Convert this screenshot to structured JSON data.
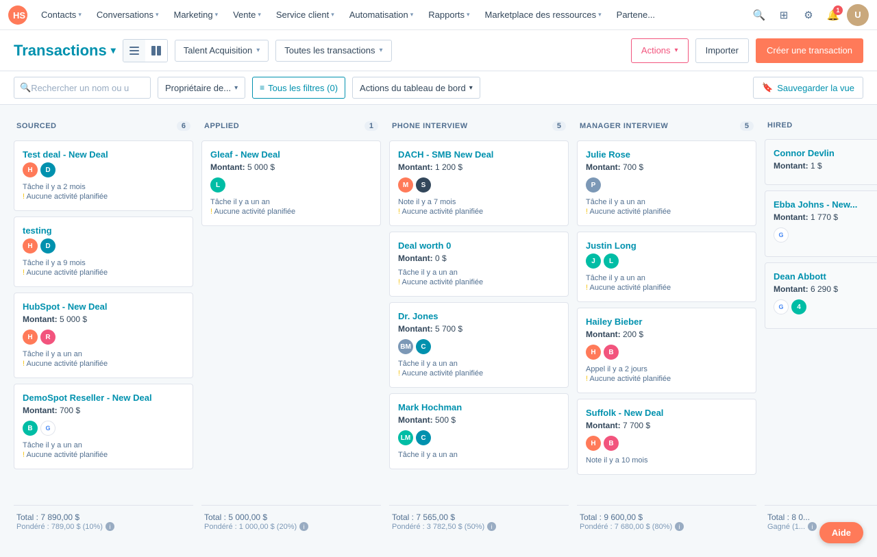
{
  "nav": {
    "logo": "HubSpot",
    "items": [
      {
        "label": "Contacts",
        "id": "contacts"
      },
      {
        "label": "Conversations",
        "id": "conversations"
      },
      {
        "label": "Marketing",
        "id": "marketing"
      },
      {
        "label": "Vente",
        "id": "vente"
      },
      {
        "label": "Service client",
        "id": "service-client"
      },
      {
        "label": "Automatisation",
        "id": "automatisation"
      },
      {
        "label": "Rapports",
        "id": "rapports"
      },
      {
        "label": "Marketplace des ressources",
        "id": "marketplace"
      },
      {
        "label": "Partene...",
        "id": "partenaires"
      }
    ]
  },
  "header": {
    "title": "Transactions",
    "view_list_label": "List view",
    "view_board_label": "Board view",
    "pipeline_label": "Talent Acquisition",
    "filter_label": "Toutes les transactions",
    "actions_label": "Actions",
    "importer_label": "Importer",
    "create_label": "Créer une transaction"
  },
  "filters": {
    "search_placeholder": "Rechercher un nom ou u",
    "owner_label": "Propriétaire de...",
    "all_filters_label": "Tous les filtres (0)",
    "board_actions_label": "Actions du tableau de bord",
    "save_view_label": "Sauvegarder la vue"
  },
  "columns": [
    {
      "id": "sourced",
      "title": "SOURCED",
      "count": 6,
      "cards": [
        {
          "name": "Test deal - New Deal",
          "amount_label": "",
          "amount_value": "",
          "avatars": [
            {
              "color": "av-orange",
              "letter": "H"
            },
            {
              "color": "av-blue",
              "letter": "D"
            }
          ],
          "meta1": "Tâche il y a 2 mois",
          "meta2": "! Aucune activité planifiée"
        },
        {
          "name": "testing",
          "amount_label": "",
          "amount_value": "",
          "avatars": [
            {
              "color": "av-orange",
              "letter": "H"
            },
            {
              "color": "av-blue",
              "letter": "D"
            }
          ],
          "meta1": "Tâche il y a 9 mois",
          "meta2": "! Aucune activité planifiée"
        },
        {
          "name": "HubSpot - New Deal",
          "amount_label": "Montant:",
          "amount_value": "5 000 $",
          "avatars": [
            {
              "color": "av-orange",
              "letter": "H"
            },
            {
              "color": "av-red",
              "letter": "R"
            }
          ],
          "meta1": "Tâche il y a un an",
          "meta2": "! Aucune activité planifiée"
        },
        {
          "name": "DemoSpot Reseller - New Deal",
          "amount_label": "Montant:",
          "amount_value": "700 $",
          "avatars": [
            {
              "color": "av-green",
              "letter": "B"
            },
            {
              "color": "av-google",
              "letter": "G"
            }
          ],
          "meta1": "Tâche il y a un an",
          "meta2": "! Aucune activité planifiée"
        }
      ],
      "total_label": "Total : 7 890,00 $",
      "weighted_label": "Pondéré : 789,00 $ (10%)"
    },
    {
      "id": "applied",
      "title": "APPLIED",
      "count": 1,
      "cards": [
        {
          "name": "Gleaf - New Deal",
          "amount_label": "Montant:",
          "amount_value": "5 000 $",
          "avatars": [
            {
              "color": "av-green",
              "letter": "L"
            }
          ],
          "meta1": "Tâche il y a un an",
          "meta2": "! Aucune activité planifiée"
        }
      ],
      "total_label": "Total : 5 000,00 $",
      "weighted_label": "Pondéré : 1 000,00 $ (20%)"
    },
    {
      "id": "phone-interview",
      "title": "PHONE INTERVIEW",
      "count": 5,
      "cards": [
        {
          "name": "DACH - SMB New Deal",
          "amount_label": "Montant:",
          "amount_value": "1 200 $",
          "avatars": [
            {
              "color": "av-orange",
              "letter": "M"
            },
            {
              "color": "av-dark",
              "letter": "S"
            }
          ],
          "meta1": "Note il y a 7 mois",
          "meta2": "! Aucune activité planifiée"
        },
        {
          "name": "Deal worth 0",
          "amount_label": "Montant:",
          "amount_value": "0 $",
          "avatars": [],
          "meta1": "Tâche il y a un an",
          "meta2": "! Aucune activité planifiée"
        },
        {
          "name": "Dr. Jones",
          "amount_label": "Montant:",
          "amount_value": "5 700 $",
          "avatars": [
            {
              "color": "av-purple",
              "letter": "BM"
            },
            {
              "color": "av-blue",
              "letter": "C"
            }
          ],
          "meta1": "Tâche il y a un an",
          "meta2": "! Aucune activité planifiée"
        },
        {
          "name": "Mark Hochman",
          "amount_label": "Montant:",
          "amount_value": "500 $",
          "avatars": [
            {
              "color": "av-teal",
              "letter": "LM"
            },
            {
              "color": "av-blue",
              "letter": "C"
            }
          ],
          "meta1": "Tâche il y a un an",
          "meta2": ""
        }
      ],
      "total_label": "Total : 7 565,00 $",
      "weighted_label": "Pondéré : 3 782,50 $ (50%)"
    },
    {
      "id": "manager-interview",
      "title": "MANAGER INTERVIEW",
      "count": 5,
      "cards": [
        {
          "name": "Julie Rose",
          "amount_label": "Montant:",
          "amount_value": "700 $",
          "avatars": [
            {
              "color": "av-purple",
              "letter": "P"
            }
          ],
          "meta1": "Tâche il y a un an",
          "meta2": "! Aucune activité planifiée"
        },
        {
          "name": "Justin Long",
          "amount_label": "Tâche il y a un an",
          "amount_value": "",
          "avatars": [
            {
              "color": "av-green",
              "letter": "J"
            },
            {
              "color": "av-teal",
              "letter": "L"
            }
          ],
          "meta1": "Tâche il y a un an",
          "meta2": "! Aucune activité planifiée"
        },
        {
          "name": "Hailey Bieber",
          "amount_label": "Montant:",
          "amount_value": "200 $",
          "avatars": [
            {
              "color": "av-orange",
              "letter": "H"
            },
            {
              "color": "av-red",
              "letter": "B"
            }
          ],
          "meta1": "Appel il y a 2 jours",
          "meta2": "! Aucune activité planifiée"
        },
        {
          "name": "Suffolk - New Deal",
          "amount_label": "Montant:",
          "amount_value": "7 700 $",
          "avatars": [
            {
              "color": "av-orange",
              "letter": "H"
            },
            {
              "color": "av-red",
              "letter": "B"
            }
          ],
          "meta1": "Note il y a 10 mois",
          "meta2": ""
        }
      ],
      "total_label": "Total : 9 600,00 $",
      "weighted_label": "Pondéré : 7 680,00 $ (80%)"
    },
    {
      "id": "hired",
      "title": "HIRED",
      "count": null,
      "cards": [
        {
          "name": "Connor Devlin",
          "amount_label": "Montant:",
          "amount_value": "1 $",
          "avatars": [],
          "meta1": "",
          "meta2": ""
        },
        {
          "name": "Ebba Johns - New...",
          "amount_label": "Montant:",
          "amount_value": "1 770 $",
          "avatars": [
            {
              "color": "av-google",
              "letter": "G"
            }
          ],
          "meta1": "",
          "meta2": ""
        },
        {
          "name": "Dean Abbott",
          "amount_label": "Montant:",
          "amount_value": "6 290 $",
          "avatars": [
            {
              "color": "av-google",
              "letter": "G"
            },
            {
              "color": "av-teal",
              "letter": "4"
            }
          ],
          "meta1": "",
          "meta2": ""
        }
      ],
      "total_label": "Total : 8 0...",
      "weighted_label": "Gagné (1..."
    }
  ],
  "aide": {
    "label": "Aide"
  }
}
